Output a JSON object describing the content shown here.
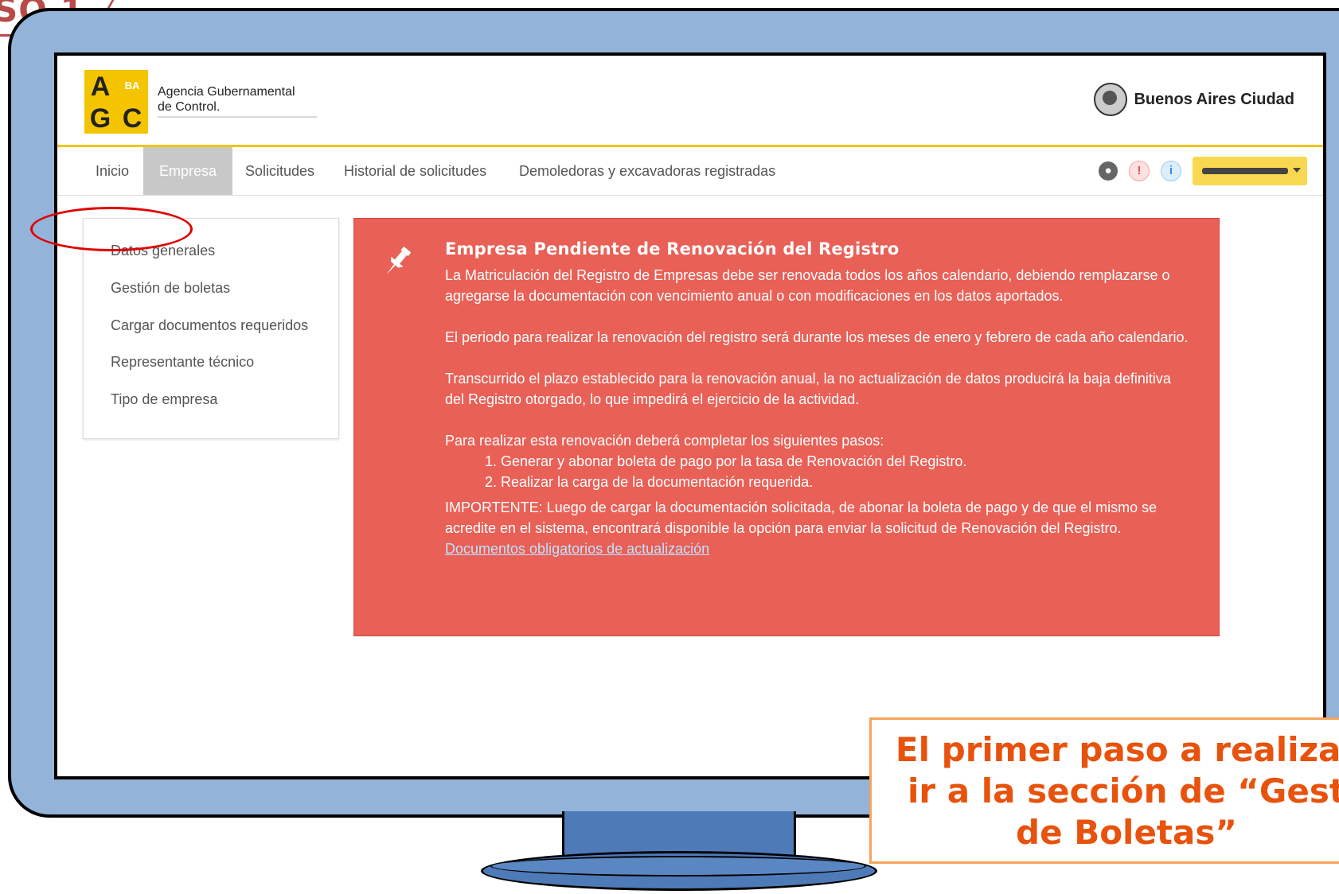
{
  "step_label": "SO 1",
  "header": {
    "logo": {
      "letters": [
        "A",
        "BA",
        "G",
        "C"
      ]
    },
    "org_line1": "Agencia Gubernamental",
    "org_line2": "de Control.",
    "city": "Buenos Aires Ciudad"
  },
  "nav": {
    "items": [
      {
        "label": "Inicio"
      },
      {
        "label": "Empresa",
        "active": true
      },
      {
        "label": "Solicitudes"
      },
      {
        "label": "Historial de solicitudes"
      },
      {
        "label": "Demoledoras y excavadoras registradas"
      }
    ],
    "icons": [
      "globe-icon",
      "alert-icon",
      "info-icon"
    ],
    "alert_glyph": "!",
    "info_glyph": "i"
  },
  "sidebar": {
    "items": [
      {
        "label": "Datos generales"
      },
      {
        "label": "Gestión de boletas",
        "highlighted": true
      },
      {
        "label": "Cargar documentos requeridos"
      },
      {
        "label": "Representante técnico"
      },
      {
        "label": "Tipo de empresa"
      }
    ]
  },
  "alert": {
    "title": "Empresa Pendiente de Renovación del Registro",
    "p1": "La Matriculación del Registro de Empresas debe ser renovada todos los años calendario, debiendo remplazarse o agregarse la documentación con vencimiento anual o con modificaciones en los datos aportados.",
    "p2": "El periodo para realizar la renovación del registro será durante los meses de enero y febrero de cada año calendario.",
    "p3": "Transcurrido el plazo establecido para la renovación anual, la no actualización de datos producirá la baja definitiva del Registro otorgado, lo que impedirá el ejercicio de la actividad.",
    "p4": "Para realizar esta renovación deberá completar los siguientes pasos:",
    "steps": [
      "1. Generar y abonar boleta de pago por la tasa de Renovación del Registro.",
      "2. Realizar la carga de la documentación requerida."
    ],
    "p5": "IMPORTENTE: Luego de cargar la documentación solicitada, de abonar la boleta de pago y de que el mismo se acredite en el sistema, encontrará disponible la opción para enviar la solicitud de Renovación del Registro.",
    "link": "Documentos obligatorios de actualización",
    "color": "#e86056"
  },
  "callout": {
    "line1": "El primer paso a realizar",
    "line2": "ir a la sección de “Gest",
    "line3": "de Boletas”",
    "color": "#e8520c"
  }
}
